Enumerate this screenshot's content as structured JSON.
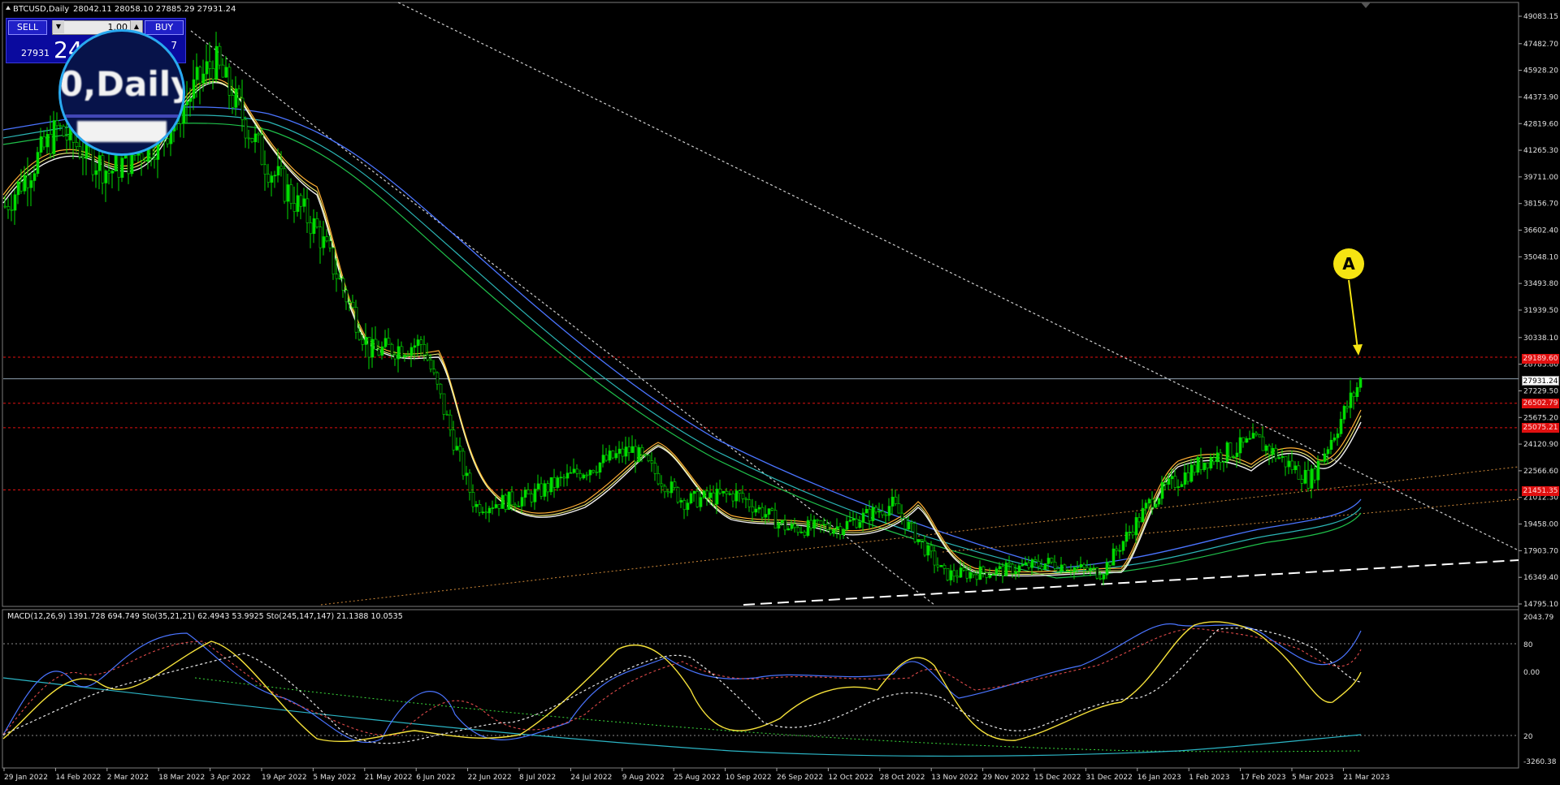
{
  "window": {
    "symbol_label": "BTCUSD,Daily",
    "ohlc_label": "28042.11 28058.10 27885.29 27931.24"
  },
  "trade_panel": {
    "sell_label": "SELL",
    "buy_label": "BUY",
    "lot_value": "1.00",
    "bid_small": "27931",
    "bid_big": "24",
    "ask_tail": "7"
  },
  "magnifier": {
    "text": "0,Daily"
  },
  "callout": {
    "label": "A"
  },
  "indicator_label": "MACD(12,26,9) 1391.728 694.749  Sto(35,21,21) 62.4943 53.9925  Sto(245,147,147) 21.1388 10.0535",
  "colors": {
    "background": "#000000",
    "candles": "#00dd00",
    "dotted_trend": "#ffffff",
    "support_line": "#d08a3a",
    "resistance": "#e01010",
    "callout": "#f5e412",
    "magnifier_ring": "#29a9f0"
  },
  "price_axis": {
    "labels": [
      "49083.15",
      "47482.70",
      "45928.20",
      "44373.90",
      "42819.60",
      "41265.30",
      "39711.00",
      "38156.70",
      "36602.40",
      "35048.10",
      "33493.80",
      "31939.50",
      "30338.10",
      "28783.80",
      "27229.50",
      "25675.20",
      "24120.90",
      "22566.60",
      "21012.30",
      "19458.00",
      "17903.70",
      "16349.40",
      "14795.10"
    ],
    "tags": {
      "r1": "29189.60",
      "current": "27931.24",
      "r2": "26502.79",
      "r3": "25075.21",
      "r4": "21451.35"
    }
  },
  "indicator_axis": {
    "labels": [
      "2043.79",
      "80",
      "0.00",
      "20",
      "-3260.38"
    ]
  },
  "time_axis": {
    "labels": [
      "29 Jan 2022",
      "14 Feb 2022",
      "2 Mar 2022",
      "18 Mar 2022",
      "3 Apr 2022",
      "19 Apr 2022",
      "5 May 2022",
      "21 May 2022",
      "6 Jun 2022",
      "22 Jun 2022",
      "8 Jul 2022",
      "24 Jul 2022",
      "9 Aug 2022",
      "25 Aug 2022",
      "10 Sep 2022",
      "26 Sep 2022",
      "12 Oct 2022",
      "28 Oct 2022",
      "13 Nov 2022",
      "29 Nov 2022",
      "15 Dec 2022",
      "31 Dec 2022",
      "16 Jan 2023",
      "1 Feb 2023",
      "17 Feb 2023",
      "5 Mar 2023",
      "21 Mar 2023"
    ]
  },
  "chart_data": {
    "type": "line",
    "title": "BTCUSD,Daily",
    "y_range": [
      14795.1,
      49083.15
    ],
    "price_path": [
      {
        "t": "29 Jan 2022",
        "v": 38000
      },
      {
        "t": "14 Feb 2022",
        "v": 42500
      },
      {
        "t": "2 Mar 2022",
        "v": 40000
      },
      {
        "t": "18 Mar 2022",
        "v": 42000
      },
      {
        "t": "3 Apr 2022",
        "v": 46500
      },
      {
        "t": "19 Apr 2022",
        "v": 40500
      },
      {
        "t": "5 May 2022",
        "v": 36500
      },
      {
        "t": "21 May 2022",
        "v": 29500
      },
      {
        "t": "6 Jun 2022",
        "v": 30000
      },
      {
        "t": "22 Jun 2022",
        "v": 20500
      },
      {
        "t": "8 Jul 2022",
        "v": 21000
      },
      {
        "t": "24 Jul 2022",
        "v": 22500
      },
      {
        "t": "9 Aug 2022",
        "v": 23800
      },
      {
        "t": "25 Aug 2022",
        "v": 20800
      },
      {
        "t": "10 Sep 2022",
        "v": 21200
      },
      {
        "t": "26 Sep 2022",
        "v": 19200
      },
      {
        "t": "12 Oct 2022",
        "v": 19300
      },
      {
        "t": "28 Oct 2022",
        "v": 20600
      },
      {
        "t": "13 Nov 2022",
        "v": 16500
      },
      {
        "t": "29 Nov 2022",
        "v": 16700
      },
      {
        "t": "15 Dec 2022",
        "v": 17200
      },
      {
        "t": "31 Dec 2022",
        "v": 16600
      },
      {
        "t": "16 Jan 2023",
        "v": 21000
      },
      {
        "t": "1 Feb 2023",
        "v": 23200
      },
      {
        "t": "17 Feb 2023",
        "v": 24300
      },
      {
        "t": "5 Mar 2023",
        "v": 22000
      },
      {
        "t": "21 Mar 2023",
        "v": 28000
      }
    ],
    "horizontal_levels": [
      29189.6,
      26502.79,
      25075.21,
      21451.35
    ],
    "current_price": 27931.24
  }
}
